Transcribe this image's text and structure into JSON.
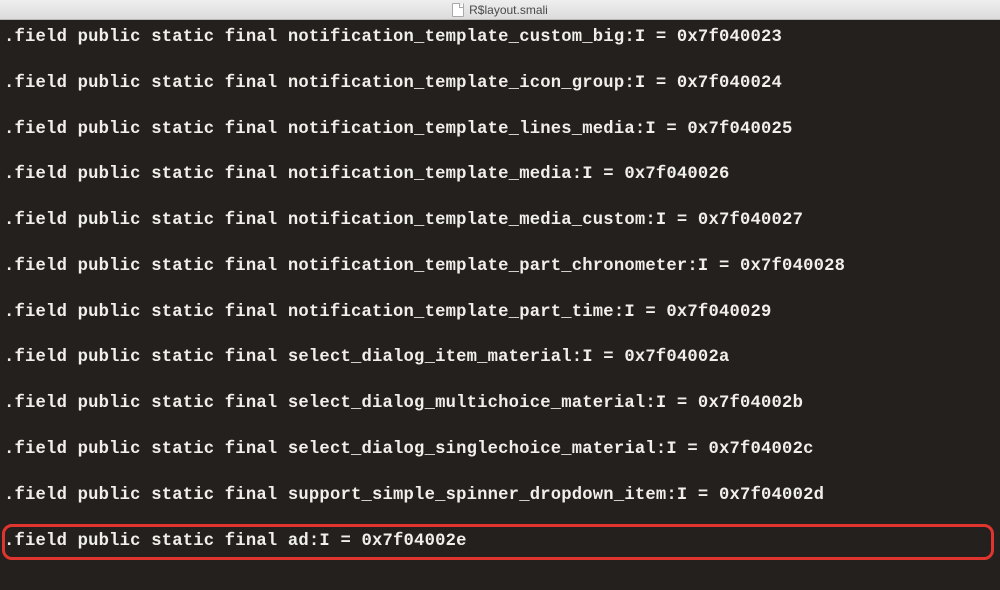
{
  "titlebar": {
    "filename": "R$layout.smali"
  },
  "code": {
    "lines": [
      ".field public static final notification_template_custom_big:I = 0x7f040023",
      ".field public static final notification_template_icon_group:I = 0x7f040024",
      ".field public static final notification_template_lines_media:I = 0x7f040025",
      ".field public static final notification_template_media:I = 0x7f040026",
      ".field public static final notification_template_media_custom:I = 0x7f040027",
      ".field public static final notification_template_part_chronometer:I = 0x7f040028",
      ".field public static final notification_template_part_time:I = 0x7f040029",
      ".field public static final select_dialog_item_material:I = 0x7f04002a",
      ".field public static final select_dialog_multichoice_material:I = 0x7f04002b",
      ".field public static final select_dialog_singlechoice_material:I = 0x7f04002c",
      ".field public static final support_simple_spinner_dropdown_item:I = 0x7f04002d",
      ".field public static final ad:I = 0x7f04002e"
    ],
    "highlighted_index": 11
  }
}
